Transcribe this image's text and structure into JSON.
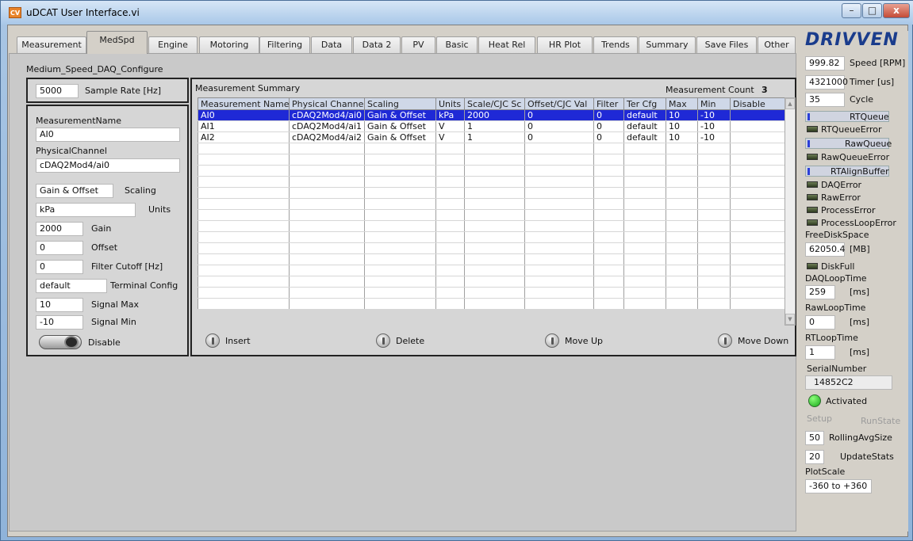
{
  "window": {
    "title": "uDCAT User Interface.vi",
    "icon_text": "CV",
    "min": "–",
    "max": "□",
    "close": "x"
  },
  "tabs": [
    "Measurement",
    "MedSpd",
    "Engine",
    "Motoring",
    "Filtering",
    "Data",
    "Data 2",
    "PV",
    "Basic",
    "Heat Rel",
    "HR Plot",
    "Trends",
    "Summary",
    "Save Files",
    "Other"
  ],
  "page": {
    "title": "Medium_Speed_DAQ_Configure"
  },
  "sample_rate": {
    "value": "5000",
    "label": "Sample Rate [Hz]"
  },
  "config": {
    "measurement_name_label": "MeasurementName",
    "measurement_name": "AI0",
    "physical_channel_label": "PhysicalChannel",
    "physical_channel": "cDAQ2Mod4/ai0",
    "scaling": "Gain & Offset",
    "scaling_label": "Scaling",
    "units": "kPa",
    "units_label": "Units",
    "gain": "2000",
    "gain_label": "Gain",
    "offset": "0",
    "offset_label": "Offset",
    "filter": "0",
    "filter_label": "Filter Cutoff [Hz]",
    "terminal": "default",
    "terminal_label": "Terminal Config",
    "signal_max": "10",
    "signal_max_label": "Signal Max",
    "signal_min": "-10",
    "signal_min_label": "Signal Min",
    "disable_label": "Disable"
  },
  "summary": {
    "title": "Measurement Summary",
    "count_label": "Measurement Count",
    "count": "3",
    "columns": [
      "Measurement Name",
      "Physical Channel",
      "Scaling",
      "Units",
      "Scale/CJC Sc",
      "Offset/CJC Val",
      "Filter",
      "Ter Cfg",
      "Max",
      "Min",
      "Disable"
    ],
    "rows": [
      [
        "AI0",
        "cDAQ2Mod4/ai0",
        "Gain & Offset",
        "kPa",
        "2000",
        "0",
        "0",
        "default",
        "10",
        "-10",
        ""
      ],
      [
        "AI1",
        "cDAQ2Mod4/ai1",
        "Gain & Offset",
        "V",
        "1",
        "0",
        "0",
        "default",
        "10",
        "-10",
        ""
      ],
      [
        "AI2",
        "cDAQ2Mod4/ai2",
        "Gain & Offset",
        "V",
        "1",
        "0",
        "0",
        "default",
        "10",
        "-10",
        ""
      ]
    ],
    "insert": "Insert",
    "delete": "Delete",
    "move_up": "Move Up",
    "move_down": "Move Down"
  },
  "side": {
    "logo": "DRIVVEN",
    "speed": "999.82",
    "speed_label": "Speed [RPM]",
    "timer": "4321000",
    "timer_label": "Timer [us]",
    "cycle": "35",
    "cycle_label": "Cycle",
    "rtqueue": "RTQueue",
    "rtqueue_error": "RTQueueError",
    "rawqueue": "RawQueue",
    "rawqueue_error": "RawQueueError",
    "rtalign": "RTAlignBuffer",
    "daq_error": "DAQError",
    "raw_error": "RawError",
    "process_error": "ProcessError",
    "process_loop_error": "ProcessLoopError",
    "free_disk_label": "FreeDiskSpace",
    "free_disk": "62050.4",
    "free_disk_unit": "[MB]",
    "disk_full": "DiskFull",
    "daq_loop_label": "DAQLoopTime",
    "daq_loop": "259",
    "daq_loop_unit": "[ms]",
    "raw_loop_label": "RawLoopTime",
    "raw_loop": "0",
    "raw_loop_unit": "[ms]",
    "rt_loop_label": "RTLoopTime",
    "rt_loop": "1",
    "rt_loop_unit": "[ms]",
    "serial_label": "SerialNumber",
    "serial": "14852C2",
    "activated": "Activated",
    "setup": "Setup",
    "runstate": "RunState",
    "rolling_avg": "50",
    "rolling_avg_label": "RollingAvgSize",
    "update_stats": "20",
    "update_stats_label": "UpdateStats",
    "plot_scale_label": "PlotScale",
    "plot_scale": "-360 to +360"
  }
}
